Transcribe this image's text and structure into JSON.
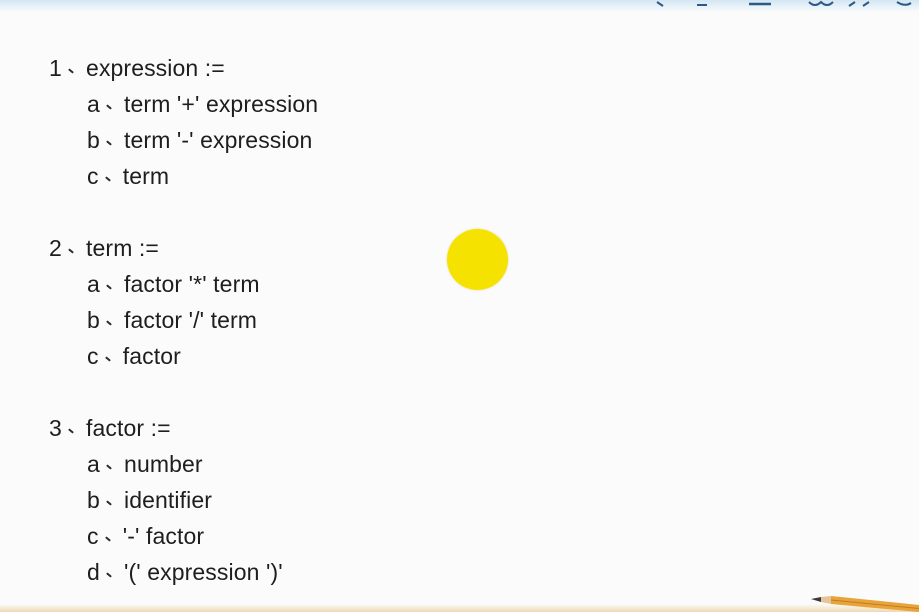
{
  "colors": {
    "text": "#1e1e1e",
    "background": "#fbfbfb",
    "cursor_highlight": "#f5e200",
    "top_band": "#d3e6f3",
    "bottom_band": "#edd9b0"
  },
  "separator_glyph": "、",
  "rules": [
    {
      "number": "1",
      "head": "expression :=",
      "alternatives": [
        {
          "letter": "a",
          "text": "term '+' expression"
        },
        {
          "letter": "b",
          "text": "term '-' expression"
        },
        {
          "letter": "c",
          "text": "term"
        }
      ]
    },
    {
      "number": "2",
      "head": "term :=",
      "alternatives": [
        {
          "letter": "a",
          "text": "factor '*' term"
        },
        {
          "letter": "b",
          "text": "factor '/' term"
        },
        {
          "letter": "c",
          "text": "factor"
        }
      ]
    },
    {
      "number": "3",
      "head": "factor :=",
      "alternatives": [
        {
          "letter": "a",
          "text": "number"
        },
        {
          "letter": "b",
          "text": "identifier"
        },
        {
          "letter": "c",
          "text": "'-' factor"
        },
        {
          "letter": "d",
          "text": "'(' expression ')'"
        }
      ]
    }
  ]
}
